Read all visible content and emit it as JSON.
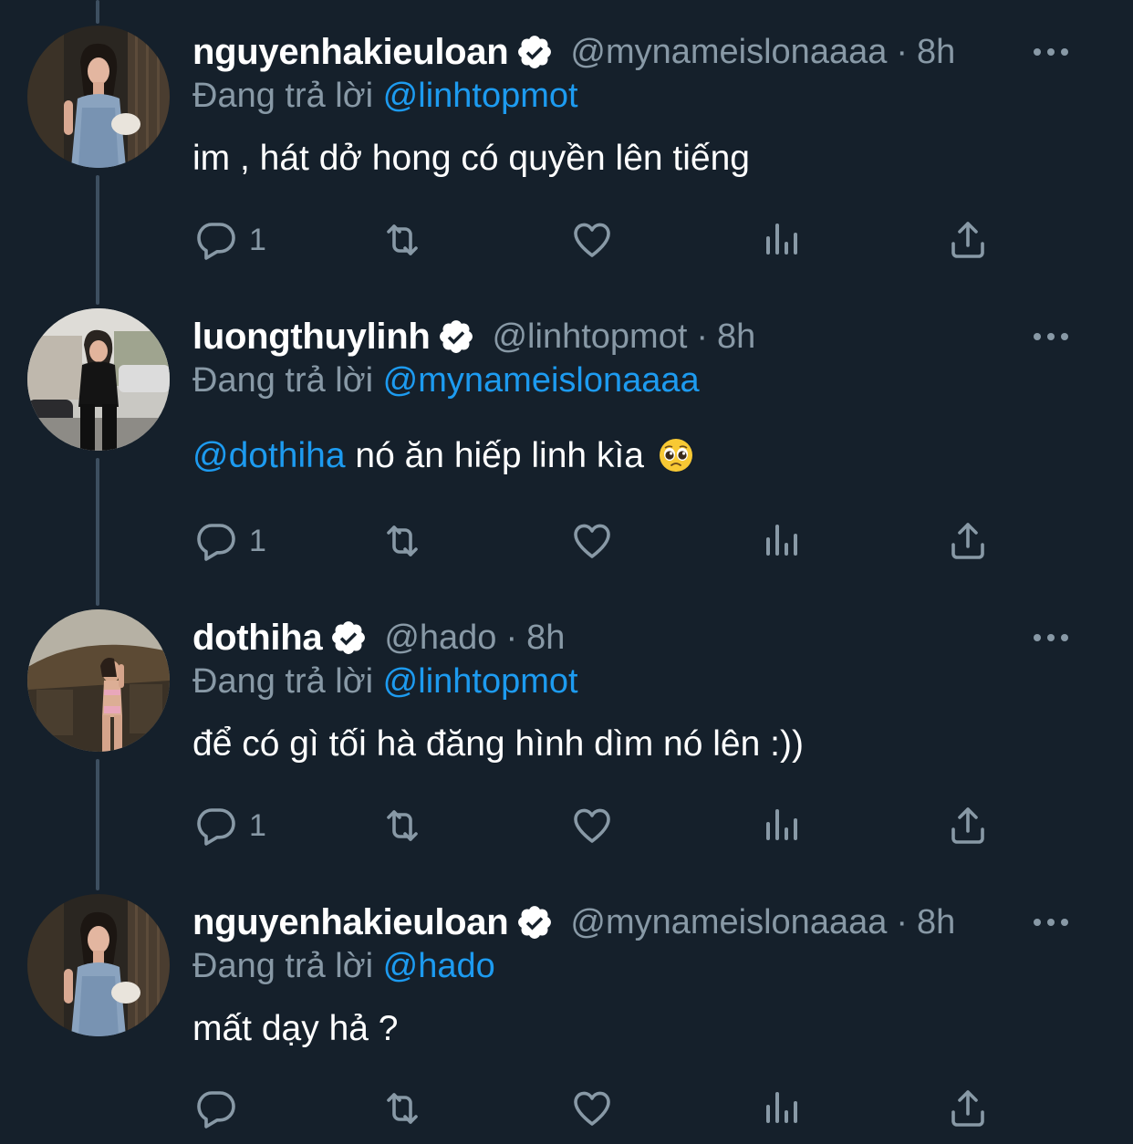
{
  "reply_prefix": "Đang trả lời",
  "separator": "·",
  "tweets": [
    {
      "display_name": "nguyenhakieuloan",
      "handle": "@mynameislonaaaa",
      "time": "8h",
      "reply_to": "@linhtopmot",
      "text": "im , hát dở hong có quyền lên tiếng",
      "mention": "",
      "reply_count": "1",
      "avatar": "avatar-woman-denim-dress"
    },
    {
      "display_name": "luongthuylinh",
      "handle": "@linhtopmot",
      "time": "8h",
      "reply_to": "@mynameislonaaaa",
      "mention": "@dothiha",
      "text": " nó ăn hiếp linh kìa",
      "emoji": "pleading-face",
      "reply_count": "1",
      "avatar": "avatar-woman-black-outfit-street"
    },
    {
      "display_name": "dothiha",
      "handle": "@hado",
      "time": "8h",
      "reply_to": "@linhtopmot",
      "text": "để có gì tối hà đăng hình dìm nó lên :))",
      "mention": "",
      "reply_count": "1",
      "avatar": "avatar-woman-bikini-hut"
    },
    {
      "display_name": "nguyenhakieuloan",
      "handle": "@mynameislonaaaa",
      "time": "8h",
      "reply_to": "@hado",
      "text": "mất dạy hả ?",
      "mention": "",
      "reply_count": "",
      "avatar": "avatar-woman-denim-dress"
    }
  ],
  "colors": {
    "background": "#15202b",
    "text_primary": "#ffffff",
    "text_secondary": "#8899a6",
    "mention": "#1d9bf0",
    "thread_line": "#3d4f60"
  }
}
